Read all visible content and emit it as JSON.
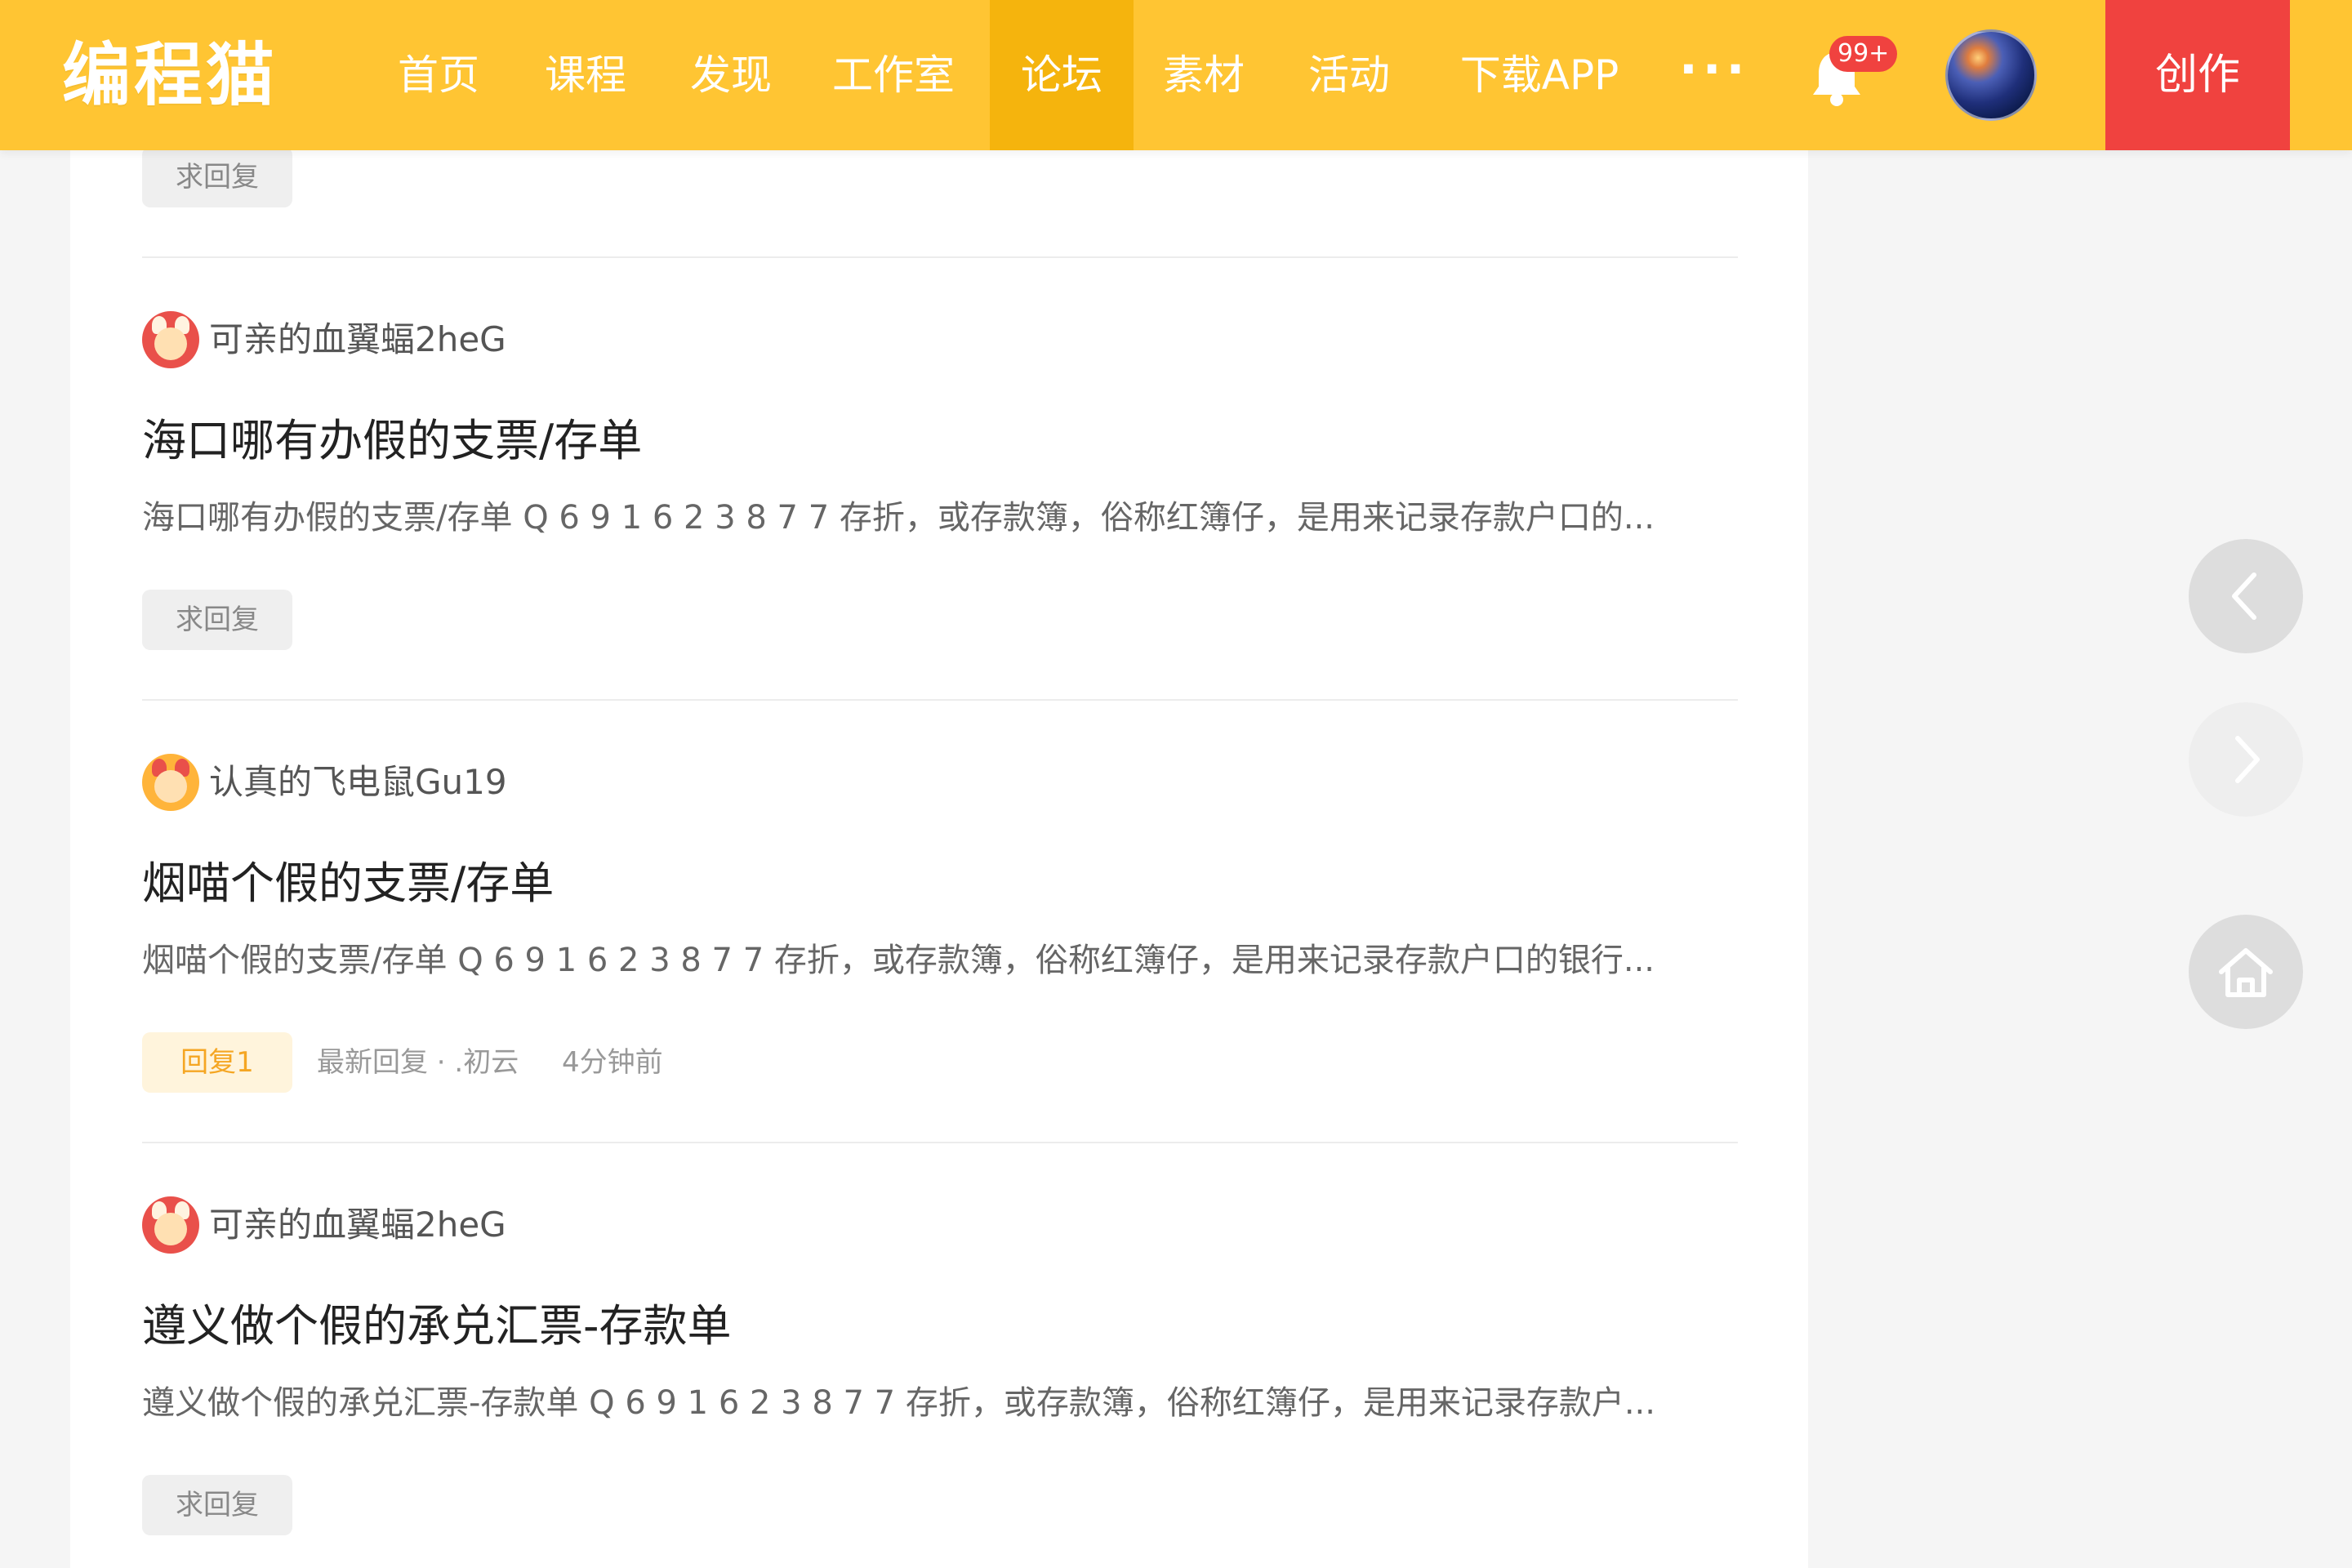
{
  "header": {
    "logo": "编程猫",
    "nav": [
      {
        "label": "首页"
      },
      {
        "label": "课程"
      },
      {
        "label": "发现"
      },
      {
        "label": "工作室"
      },
      {
        "label": "论坛"
      },
      {
        "label": "素材"
      },
      {
        "label": "活动"
      },
      {
        "label": "下载APP"
      }
    ],
    "active_nav": "论坛",
    "more": "···",
    "notification_badge": "99+",
    "create_label": "创作"
  },
  "posts": [
    {
      "tag": "求回复"
    },
    {
      "author": "可亲的血翼蝠2heG",
      "title": "海口哪有办假的支票/存单",
      "excerpt": "海口哪有办假的支票/存单 Q 6 9 1 6 2 3 8 7 7 存折，或存款簿，俗称红簿仔，是用来记录存款户口的...",
      "tag": "求回复"
    },
    {
      "author": "认真的飞电鼠Gu19",
      "title": "烟喵个假的支票/存单",
      "excerpt": "烟喵个假的支票/存单 Q 6 9 1 6 2 3 8 7 7 存折，或存款簿，俗称红簿仔，是用来记录存款户口的银行...",
      "reply_tag": "回复1",
      "latest_reply": "最新回复 · .初云",
      "time": "4分钟前"
    },
    {
      "author": "可亲的血翼蝠2heG",
      "title": "遵义做个假的承兑汇票-存款单",
      "excerpt": "遵义做个假的承兑汇票-存款单 Q 6 9 1 6 2 3 8 7 7 存折，或存款簿，俗称红簿仔，是用来记录存款户...",
      "tag": "求回复"
    }
  ],
  "colors": {
    "header_bg": "#ffc533",
    "active_nav_bg": "#f5b40d",
    "create_bg": "#f0423f",
    "reply_tag_text": "#f5a623"
  },
  "icons": {
    "bell": "bell-icon",
    "prev": "chevron-left-icon",
    "next": "chevron-right-icon",
    "home": "home-icon"
  }
}
